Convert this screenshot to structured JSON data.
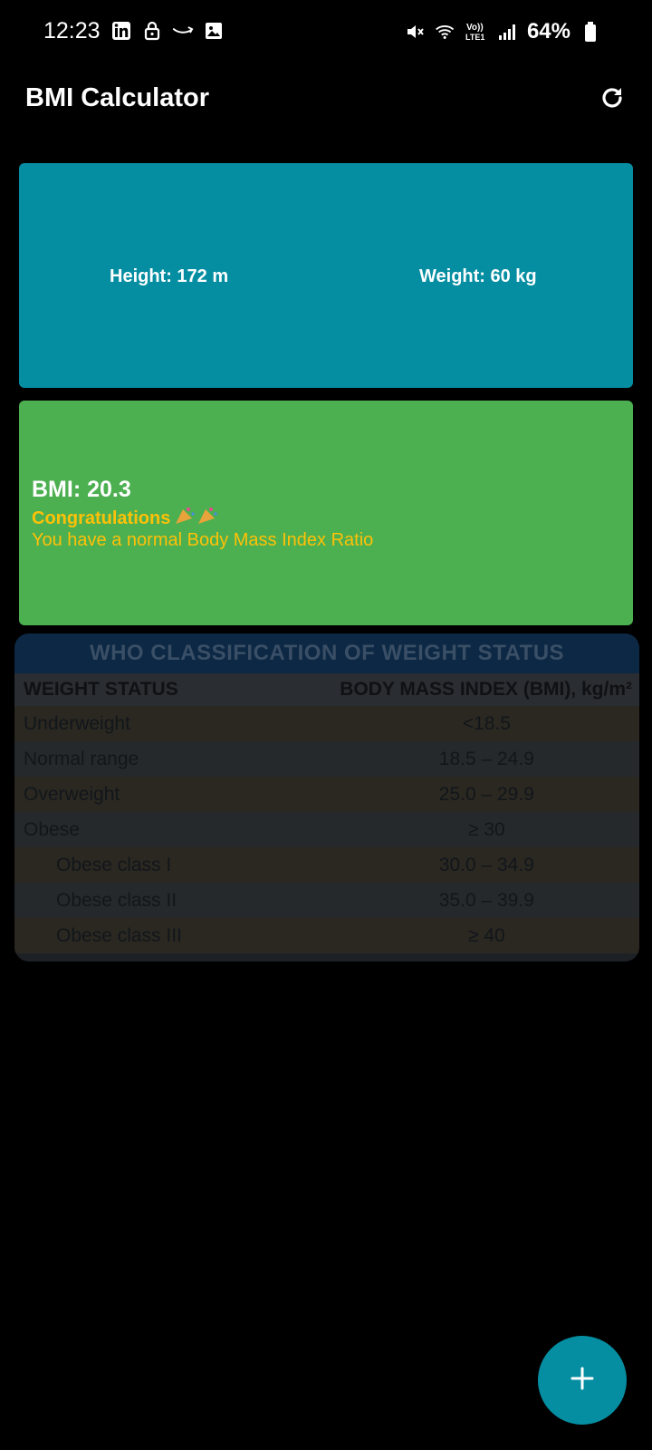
{
  "status_bar": {
    "time": "12:23",
    "battery": "64%",
    "left_icons": [
      "linkedin-icon",
      "lock-icon",
      "amazon-icon",
      "gallery-icon"
    ],
    "right_icons": [
      "mute-icon",
      "wifi-icon",
      "volte-lte-icon",
      "signal-icon",
      "battery-icon"
    ]
  },
  "app_bar": {
    "title": "BMI Calculator",
    "action_icon": "refresh-icon"
  },
  "input_card": {
    "height_label": "Height: 172 m",
    "weight_label": "Weight: 60 kg",
    "color": "#058EA2"
  },
  "result_card": {
    "bmi": "BMI: 20.3",
    "congrats": "Congratulations",
    "message": "You have a normal Body Mass Index Ratio",
    "color": "#4CAF50",
    "text_accent": "#FFC107"
  },
  "who_table": {
    "title": "WHO CLASSIFICATION OF WEIGHT STATUS",
    "headers": [
      "WEIGHT STATUS",
      "BODY MASS INDEX (BMI), kg/m²"
    ],
    "rows": [
      {
        "status": "Underweight",
        "bmi": "<18.5"
      },
      {
        "status": "Normal range",
        "bmi": "18.5 – 24.9"
      },
      {
        "status": "Overweight",
        "bmi": "25.0 – 29.9"
      },
      {
        "status": "Obese",
        "bmi": "≥ 30"
      },
      {
        "status": "Obese class I",
        "bmi": "30.0 – 34.9"
      },
      {
        "status": "Obese class II",
        "bmi": "35.0 – 39.9"
      },
      {
        "status": "Obese class III",
        "bmi": "≥ 40"
      }
    ]
  },
  "fab": {
    "icon": "plus-icon",
    "color": "#058EA2"
  }
}
